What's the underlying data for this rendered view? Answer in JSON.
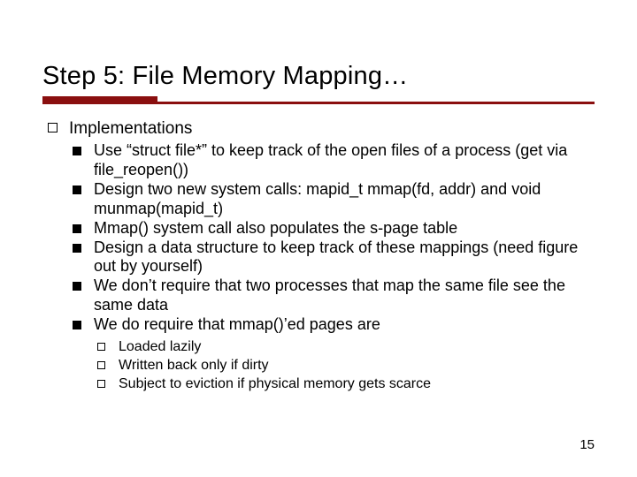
{
  "slide": {
    "title": "Step 5: File Memory Mapping…",
    "page_number": "15"
  },
  "content": {
    "heading": "Implementations",
    "bullets": [
      "Use “struct file*” to keep track of the open files of a process (get via file_reopen())",
      "Design two new system calls: mapid_t mmap(fd, addr) and void munmap(mapid_t)",
      "Mmap() system call also populates the s-page table",
      "Design a data structure to keep track of these mappings (need figure out by yourself)",
      "We don’t require that two processes that map the same file see the same data",
      "We do require that mmap()’ed pages are"
    ],
    "sub_bullets": [
      "Loaded lazily",
      "Written back only if dirty",
      "Subject to eviction if physical memory gets scarce"
    ]
  }
}
